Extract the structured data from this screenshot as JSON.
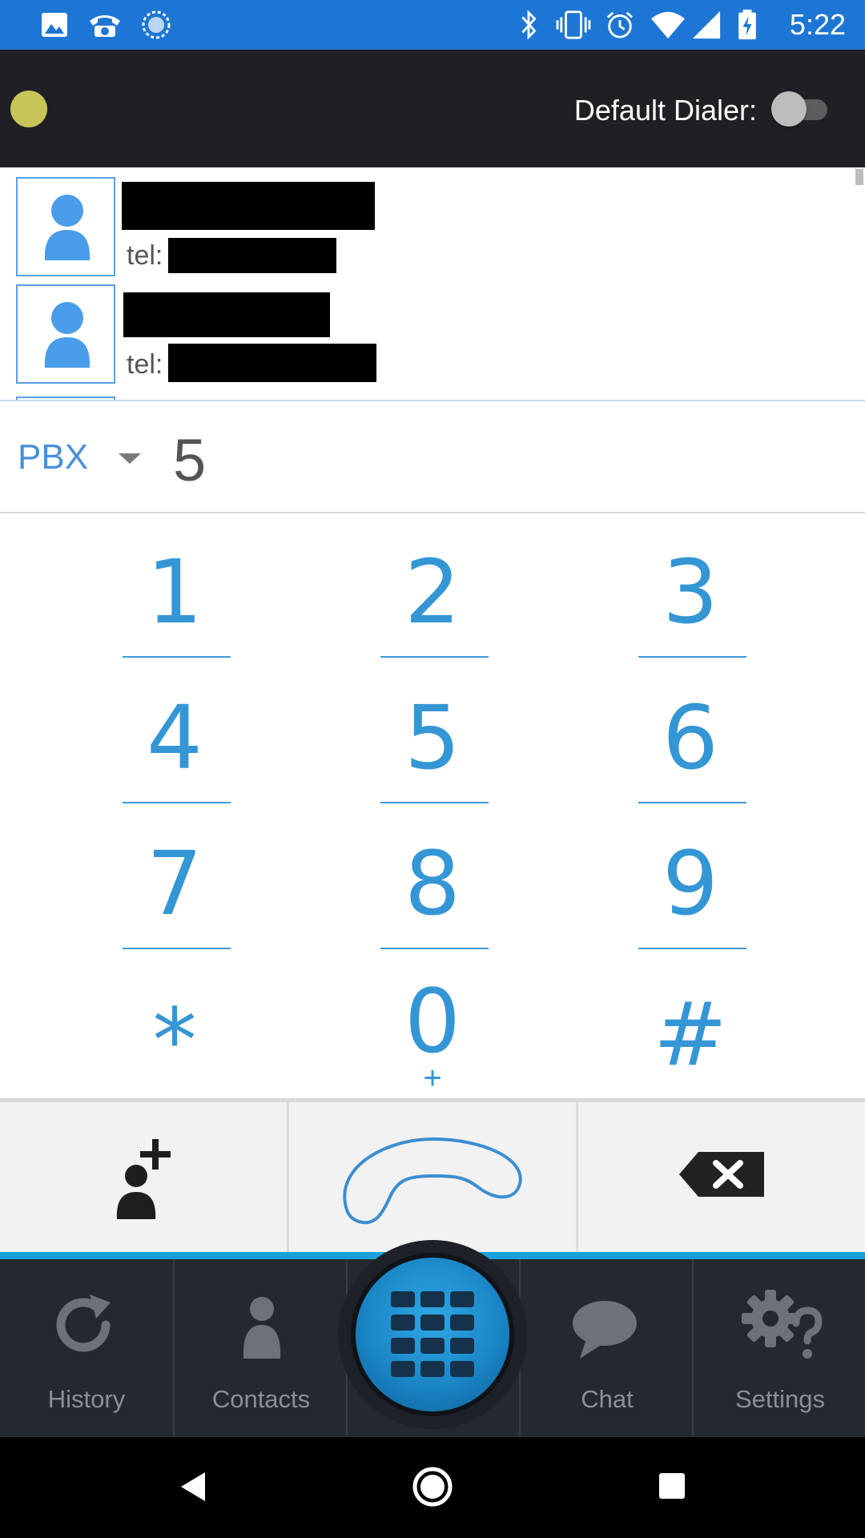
{
  "status_bar": {
    "time": "5:22",
    "left_icons": [
      "image-icon",
      "voicemail-icon",
      "sync-icon"
    ],
    "right_icons": [
      "bluetooth-icon",
      "vibrate-icon",
      "alarm-icon",
      "wifi-icon",
      "signal-icon",
      "battery-charging-icon"
    ]
  },
  "header": {
    "default_dialer_label": "Default Dialer:",
    "default_dialer_enabled": false,
    "status_color": "#c7c45a"
  },
  "contacts": [
    {
      "name": "[redacted]",
      "tel_label": "tel:",
      "number": "[redacted]"
    },
    {
      "name": "[redacted]",
      "tel_label": "tel:",
      "number": "[redacted]"
    }
  ],
  "dial": {
    "account": "PBX",
    "number": "5"
  },
  "keypad": {
    "keys": [
      {
        "digit": "1",
        "sub": ""
      },
      {
        "digit": "2",
        "sub": ""
      },
      {
        "digit": "3",
        "sub": ""
      },
      {
        "digit": "4",
        "sub": ""
      },
      {
        "digit": "5",
        "sub": ""
      },
      {
        "digit": "6",
        "sub": ""
      },
      {
        "digit": "7",
        "sub": ""
      },
      {
        "digit": "8",
        "sub": ""
      },
      {
        "digit": "9",
        "sub": ""
      },
      {
        "digit": "*",
        "sub": ""
      },
      {
        "digit": "0",
        "sub": "+"
      },
      {
        "digit": "#",
        "sub": ""
      }
    ]
  },
  "actions": {
    "add_contact_icon": "add-contact-icon",
    "call_icon": "phone-handset-icon",
    "backspace_icon": "backspace-icon"
  },
  "nav": {
    "history": "History",
    "contacts": "Contacts",
    "chat": "Chat",
    "settings": "Settings"
  },
  "colors": {
    "accent": "#3496d5",
    "status_bar": "#1d76d3",
    "header_bg": "#1f2024",
    "nav_bg": "#24282f"
  }
}
